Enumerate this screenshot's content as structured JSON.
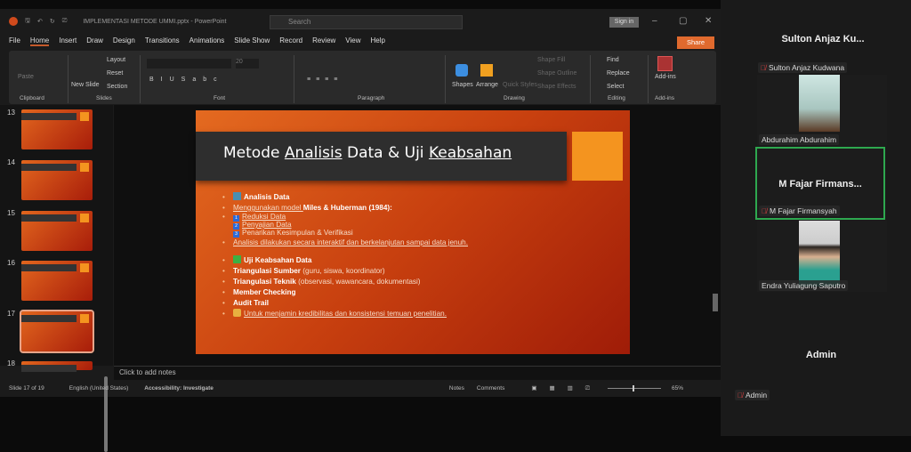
{
  "window": {
    "title": "IMPLEMENTASI METODE UMMI.pptx - PowerPoint",
    "search_placeholder": "Search",
    "sign_in": "Sign in",
    "share": "Share"
  },
  "tabs": [
    "File",
    "Home",
    "Insert",
    "Draw",
    "Design",
    "Transitions",
    "Animations",
    "Slide Show",
    "Record",
    "Review",
    "View",
    "Help"
  ],
  "active_tab": "Home",
  "ribbon": {
    "groups": [
      "Clipboard",
      "Slides",
      "Font",
      "Paragraph",
      "Drawing",
      "Editing",
      "Add-ins"
    ],
    "paste": "Paste",
    "new_slide": "New Slide",
    "layout": "Layout",
    "reset": "Reset",
    "section": "Section",
    "font_size": "20",
    "shapes": "Shapes",
    "arrange": "Arrange",
    "quick_styles": "Quick Styles",
    "shape_fill": "Shape Fill",
    "shape_outline": "Shape Outline",
    "shape_effects": "Shape Effects",
    "find": "Find",
    "replace": "Replace",
    "select": "Select",
    "addins": "Add-ins"
  },
  "thumbnails": [
    "13",
    "14",
    "15",
    "16",
    "17",
    "18"
  ],
  "selected_slide": "17",
  "slide": {
    "title_parts": [
      "Metode ",
      "Analisis",
      " Data & Uji ",
      "Keabsahan"
    ],
    "lines": [
      {
        "bold": "Analisis Data",
        "icon": "chart-icon"
      },
      {
        "pre": "Menggunakan model ",
        "bold": "Miles & Huberman (1984):"
      },
      {
        "steps": [
          "Reduksi Data",
          "Penyajian Data",
          "Penarikan Kesimpulan & Verifikasi"
        ]
      },
      {
        "text": "Analisis dilakukan secara interaktif dan berkelanjutan sampai data jenuh."
      },
      {
        "bold": "Uji Keabsahan Data",
        "icon": "check-icon"
      },
      {
        "bold": "Triangulasi Sumber",
        "rest": " (guru, siswa, koordinator)"
      },
      {
        "bold": "Triangulasi Teknik",
        "rest": " (observasi, wawancara, dokumentasi)"
      },
      {
        "bold": "Member Checking"
      },
      {
        "bold": "Audit Trail"
      },
      {
        "text": "Untuk menjamin kredibilitas dan konsistensi temuan penelitian.",
        "icon": "pencil-icon"
      }
    ]
  },
  "notes_placeholder": "Click to add notes",
  "status": {
    "slide": "Slide 17 of 19",
    "language": "English (United States)",
    "accessibility": "Accessibility: Investigate",
    "notes": "Notes",
    "comments": "Comments",
    "zoom": "65%",
    "zoom_percent": 65
  },
  "meeting": {
    "top_name": "Sulton Anjaz Ku...",
    "participants": [
      {
        "label": "Sulton Anjaz Kudwana",
        "muted": true
      },
      {
        "label": "Abdurahim Abdurahim",
        "muted": false
      },
      {
        "title": "M Fajar Firmans...",
        "label": "M Fajar Firmansyah",
        "muted": true,
        "speaking": true
      },
      {
        "label": "Endra Yuliagung Saputro",
        "muted": false
      }
    ],
    "bottom_title": "Admin",
    "bottom_label": "Admin"
  },
  "colors": {
    "accent": "#e06a2e",
    "speaking": "#2ea84f",
    "slide_bg": "#c8400f"
  }
}
